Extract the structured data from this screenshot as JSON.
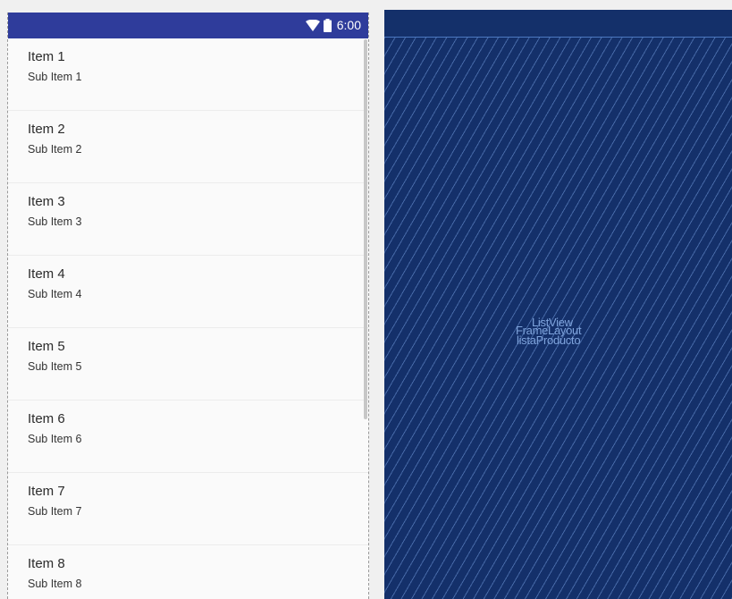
{
  "status_bar": {
    "time": "6:00",
    "icons": [
      "wifi-icon",
      "battery-icon"
    ],
    "color": "#2f3c9b"
  },
  "list": {
    "items": [
      {
        "title": "Item 1",
        "subtitle": "Sub Item 1"
      },
      {
        "title": "Item 2",
        "subtitle": "Sub Item 2"
      },
      {
        "title": "Item 3",
        "subtitle": "Sub Item 3"
      },
      {
        "title": "Item 4",
        "subtitle": "Sub Item 4"
      },
      {
        "title": "Item 5",
        "subtitle": "Sub Item 5"
      },
      {
        "title": "Item 6",
        "subtitle": "Sub Item 6"
      },
      {
        "title": "Item 7",
        "subtitle": "Sub Item 7"
      },
      {
        "title": "Item 8",
        "subtitle": "Sub Item 8"
      }
    ]
  },
  "blueprint": {
    "component_type": "ListView",
    "layout_label": "FrameLayout",
    "component_id": "listaProducto",
    "background": "#14306a",
    "line_color": "#7ea3dc"
  }
}
